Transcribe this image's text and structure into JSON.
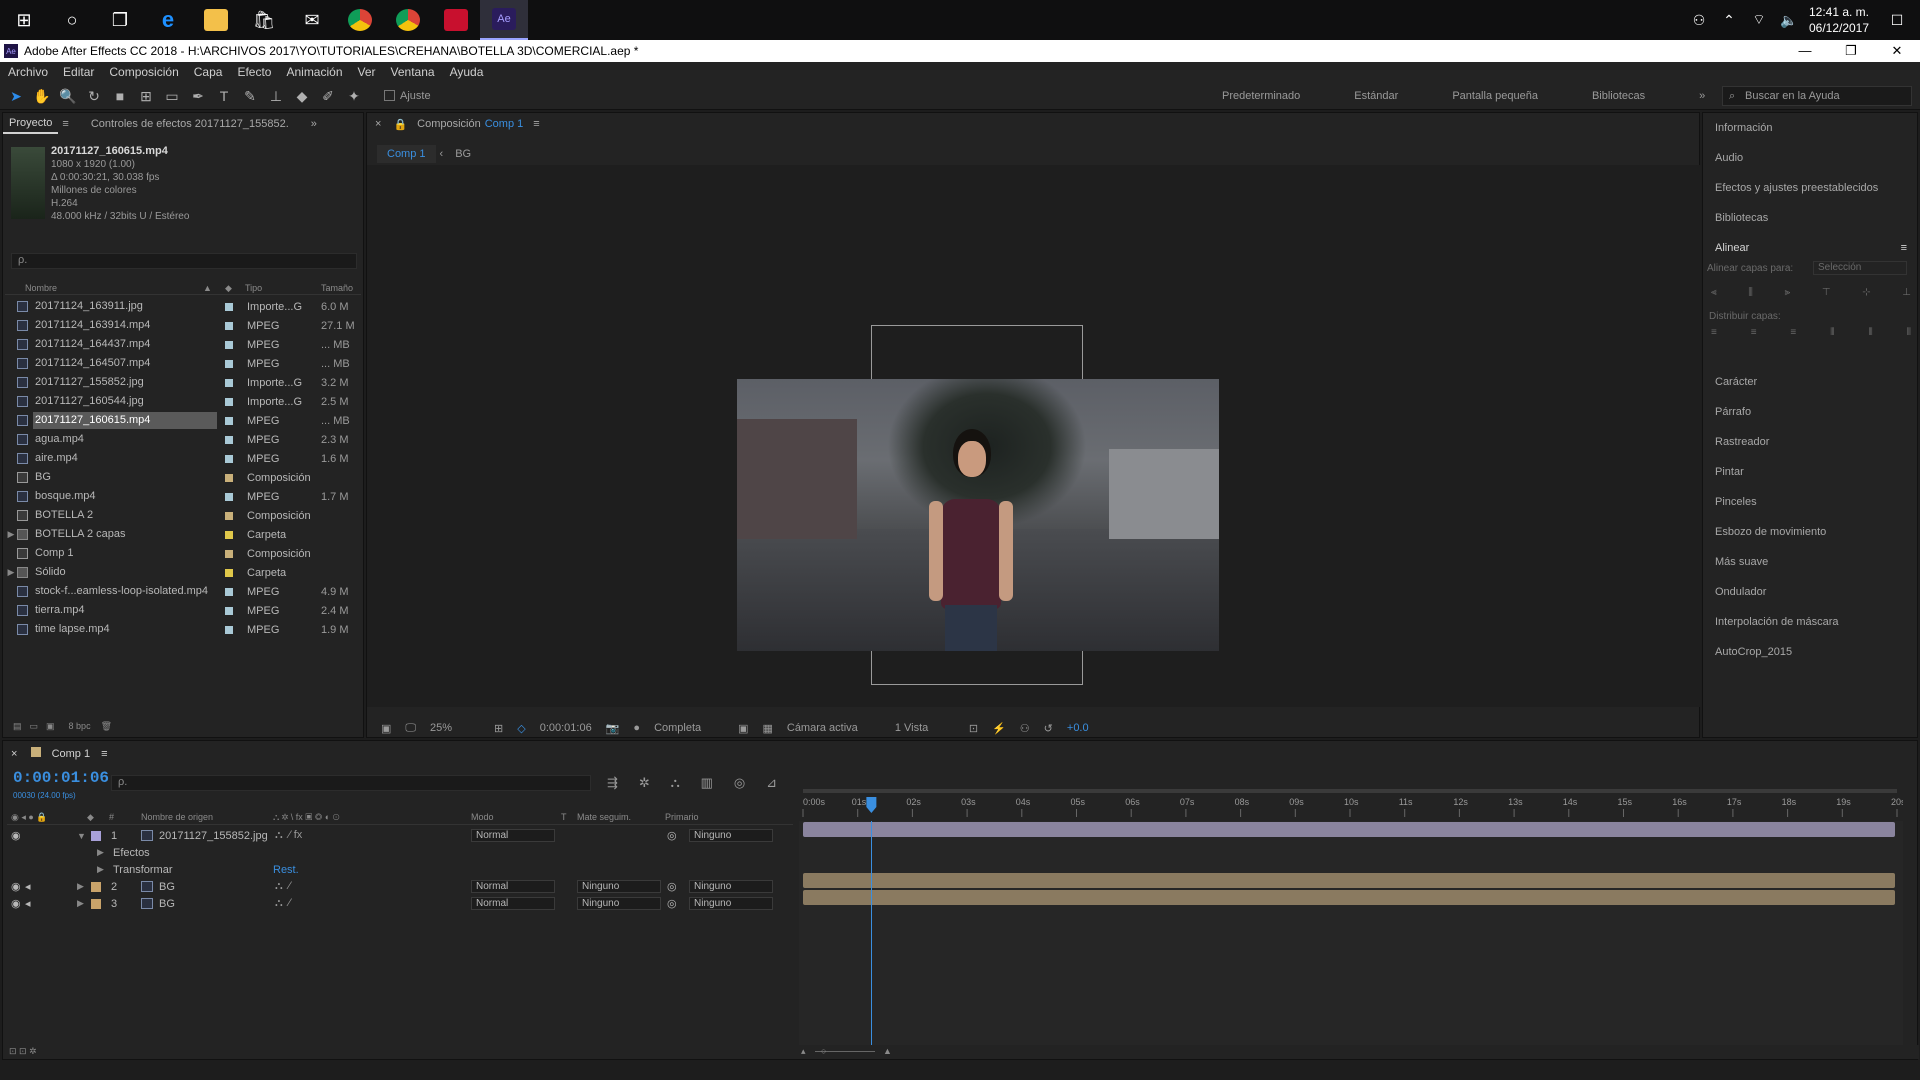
{
  "taskbar": {
    "clock_time": "12:41 a. m.",
    "clock_date": "06/12/2017"
  },
  "window": {
    "title": "Adobe After Effects CC 2018 - H:\\ARCHIVOS 2017\\YO\\TUTORIALES\\CREHANA\\BOTELLA 3D\\COMERCIAL.aep *"
  },
  "menu": [
    "Archivo",
    "Editar",
    "Composición",
    "Capa",
    "Efecto",
    "Animación",
    "Ver",
    "Ventana",
    "Ayuda"
  ],
  "toolbar": {
    "snap_label": "Ajuste",
    "workspaces": [
      "Predeterminado",
      "Estándar",
      "Pantalla pequeña",
      "Bibliotecas"
    ],
    "help_placeholder": "Buscar en la Ayuda"
  },
  "project": {
    "tab": "Proyecto",
    "effect_tab": "Controles de efectos 20171127_155852.",
    "selected_file": "20171127_160615.mp4",
    "info": [
      "1080 x 1920 (1.00)",
      "Δ 0:00:30:21, 30.038 fps",
      "Millones de colores",
      "H.264",
      "48.000 kHz / 32bits U / Estéreo"
    ],
    "search_placeholder": "ρ.",
    "columns": {
      "name": "Nombre",
      "type": "Tipo",
      "size": "Tamaño"
    },
    "items": [
      {
        "name": "20171124_163911.jpg",
        "type": "Importe...G",
        "size": "6.0 M",
        "color": "#a9c9d6",
        "kind": "file"
      },
      {
        "name": "20171124_163914.mp4",
        "type": "MPEG",
        "size": "27.1 M",
        "color": "#a9c9d6",
        "kind": "file"
      },
      {
        "name": "20171124_164437.mp4",
        "type": "MPEG",
        "size": "... MB",
        "color": "#a9c9d6",
        "kind": "file"
      },
      {
        "name": "20171124_164507.mp4",
        "type": "MPEG",
        "size": "... MB",
        "color": "#a9c9d6",
        "kind": "file"
      },
      {
        "name": "20171127_155852.jpg",
        "type": "Importe...G",
        "size": "3.2 M",
        "color": "#a9c9d6",
        "kind": "file"
      },
      {
        "name": "20171127_160544.jpg",
        "type": "Importe...G",
        "size": "2.5 M",
        "color": "#a9c9d6",
        "kind": "file"
      },
      {
        "name": "20171127_160615.mp4",
        "type": "MPEG",
        "size": "... MB",
        "color": "#a9c9d6",
        "kind": "file",
        "selected": true
      },
      {
        "name": "agua.mp4",
        "type": "MPEG",
        "size": "2.3 M",
        "color": "#a9c9d6",
        "kind": "file"
      },
      {
        "name": "aire.mp4",
        "type": "MPEG",
        "size": "1.6 M",
        "color": "#a9c9d6",
        "kind": "file"
      },
      {
        "name": "BG",
        "type": "Composición",
        "size": "",
        "color": "#c9b07a",
        "kind": "comp"
      },
      {
        "name": "bosque.mp4",
        "type": "MPEG",
        "size": "1.7 M",
        "color": "#a9c9d6",
        "kind": "file"
      },
      {
        "name": "BOTELLA 2",
        "type": "Composición",
        "size": "",
        "color": "#c9b07a",
        "kind": "comp"
      },
      {
        "name": "BOTELLA 2 capas",
        "type": "Carpeta",
        "size": "",
        "color": "#e0c84a",
        "kind": "folder"
      },
      {
        "name": "Comp 1",
        "type": "Composición",
        "size": "",
        "color": "#c9b07a",
        "kind": "comp"
      },
      {
        "name": "Sólido",
        "type": "Carpeta",
        "size": "",
        "color": "#e0c84a",
        "kind": "folder"
      },
      {
        "name": "stock-f...eamless-loop-isolated.mp4",
        "type": "MPEG",
        "size": "4.9 M",
        "color": "#a9c9d6",
        "kind": "file"
      },
      {
        "name": "tierra.mp4",
        "type": "MPEG",
        "size": "2.4 M",
        "color": "#a9c9d6",
        "kind": "file"
      },
      {
        "name": "time lapse.mp4",
        "type": "MPEG",
        "size": "1.9 M",
        "color": "#a9c9d6",
        "kind": "file"
      }
    ],
    "footer_bpc": "8 bpc"
  },
  "composition": {
    "tab_prefix": "Composición",
    "tab_name": "Comp 1",
    "flow": [
      "Comp 1",
      "BG"
    ],
    "zoom": "25%",
    "timecode": "0:00:01:06",
    "resolution": "Completa",
    "camera": "Cámara activa",
    "views": "1 Vista",
    "exposure": "+0.0"
  },
  "right_panel": [
    "Información",
    "Audio",
    "Efectos y ajustes preestablecidos",
    "Bibliotecas",
    "Alinear",
    "Carácter",
    "Párrafo",
    "Rastreador",
    "Pintar",
    "Pinceles",
    "Esbozo de movimiento",
    "Más suave",
    "Ondulador",
    "Interpolación de máscara",
    "AutoCrop_2015"
  ],
  "align": {
    "title": "Alinear",
    "align_to_label": "Alinear capas para:",
    "align_to_value": "Selección",
    "distribute_label": "Distribuir capas:"
  },
  "timeline": {
    "tab": "Comp 1",
    "timecode": "0:00:01:06",
    "subcode": "00030 (24.00 fps)",
    "search_placeholder": "ρ.",
    "columns": {
      "source": "Nombre de origen",
      "mode": "Modo",
      "t": "T",
      "matte": "Mate seguim.",
      "parent": "Primario"
    },
    "layers": [
      {
        "num": "1",
        "name": "20171127_155852.jpg",
        "mode": "Normal",
        "matte": "",
        "parent": "Ninguno",
        "color": "#a8a0d8",
        "bar": "#8a849e"
      },
      {
        "sub": "Efectos"
      },
      {
        "sub": "Transformar",
        "action": "Rest."
      },
      {
        "num": "2",
        "name": "BG",
        "mode": "Normal",
        "matte": "Ninguno",
        "parent": "Ninguno",
        "color": "#c9a36a",
        "bar": "#8a7a60"
      },
      {
        "num": "3",
        "name": "BG",
        "mode": "Normal",
        "matte": "Ninguno",
        "parent": "Ninguno",
        "color": "#c9a36a",
        "bar": "#8a7a60"
      }
    ],
    "ruler": [
      "0:00s",
      "01s",
      "02s",
      "03s",
      "04s",
      "05s",
      "06s",
      "07s",
      "08s",
      "09s",
      "10s",
      "11s",
      "12s",
      "13s",
      "14s",
      "15s",
      "16s",
      "17s",
      "18s",
      "19s",
      "20s"
    ],
    "playhead_seconds": 1.25,
    "duration_seconds": 20
  },
  "colors": {
    "accent": "#2d8ceb",
    "timecode": "#3a8fe0",
    "panel": "#232323"
  }
}
